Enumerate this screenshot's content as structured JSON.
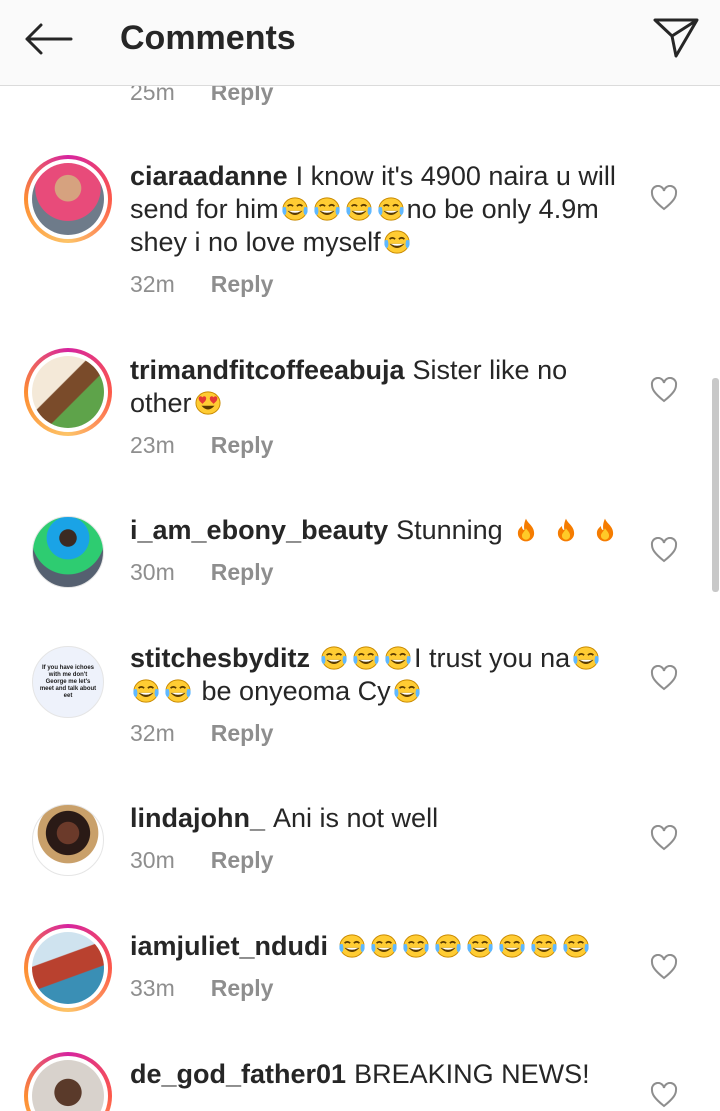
{
  "header": {
    "title": "Comments",
    "back_icon": "arrow-left-icon",
    "share_icon": "direct-send-icon"
  },
  "partial_top": {
    "time": "25m",
    "reply": "Reply"
  },
  "comments": [
    {
      "username": "ciaraadanne",
      "text_parts": [
        "I know it's 4900 naira u will send for him",
        "no be only 4.9m shey i no love myself"
      ],
      "emojis": [
        "face-with-tears-of-joy",
        "face-with-tears-of-joy",
        "face-with-tears-of-joy",
        "face-with-tears-of-joy",
        "face-with-tears-of-joy"
      ],
      "time": "32m",
      "reply": "Reply",
      "avatar_ring": true
    },
    {
      "username": "trimandfitcoffeeabuja",
      "text_parts": [
        "Sister like no other"
      ],
      "emojis": [
        "heart-eyes"
      ],
      "time": "23m",
      "reply": "Reply",
      "avatar_ring": true
    },
    {
      "username": "i_am_ebony_beauty",
      "text_parts": [
        "Stunning"
      ],
      "emojis": [
        "fire",
        "fire",
        "fire"
      ],
      "time": "30m",
      "reply": "Reply",
      "avatar_ring": false
    },
    {
      "username": "stitchesbyditz",
      "text_parts": [
        "I trust you na",
        "be onyeoma Cy"
      ],
      "emojis": [
        "face-with-tears-of-joy",
        "face-with-tears-of-joy",
        "face-with-tears-of-joy",
        "face-with-tears-of-joy",
        "face-with-tears-of-joy",
        "face-with-tears-of-joy",
        "face-with-tears-of-joy"
      ],
      "avatar_text": "If you have ichoes with me don't George me let's meet and talk about eet",
      "time": "32m",
      "reply": "Reply",
      "avatar_ring": false
    },
    {
      "username": "lindajohn_",
      "text_parts": [
        "Ani is not well"
      ],
      "emojis": [],
      "time": "30m",
      "reply": "Reply",
      "avatar_ring": false
    },
    {
      "username": "iamjuliet_ndudi",
      "text_parts": [],
      "emojis": [
        "face-with-tears-of-joy",
        "face-with-tears-of-joy",
        "face-with-tears-of-joy",
        "face-with-tears-of-joy",
        "face-with-tears-of-joy",
        "face-with-tears-of-joy",
        "face-with-tears-of-joy",
        "face-with-tears-of-joy"
      ],
      "time": "33m",
      "reply": "Reply",
      "avatar_ring": true
    },
    {
      "username": "de_god_father01",
      "text_parts": [
        "BREAKING NEWS!"
      ],
      "emojis": [],
      "avatar_ring": true
    }
  ],
  "colors": {
    "text": "#262626",
    "meta": "#8e8e8e",
    "header_bg": "#fafafa",
    "story_ring": "#d6249f"
  }
}
